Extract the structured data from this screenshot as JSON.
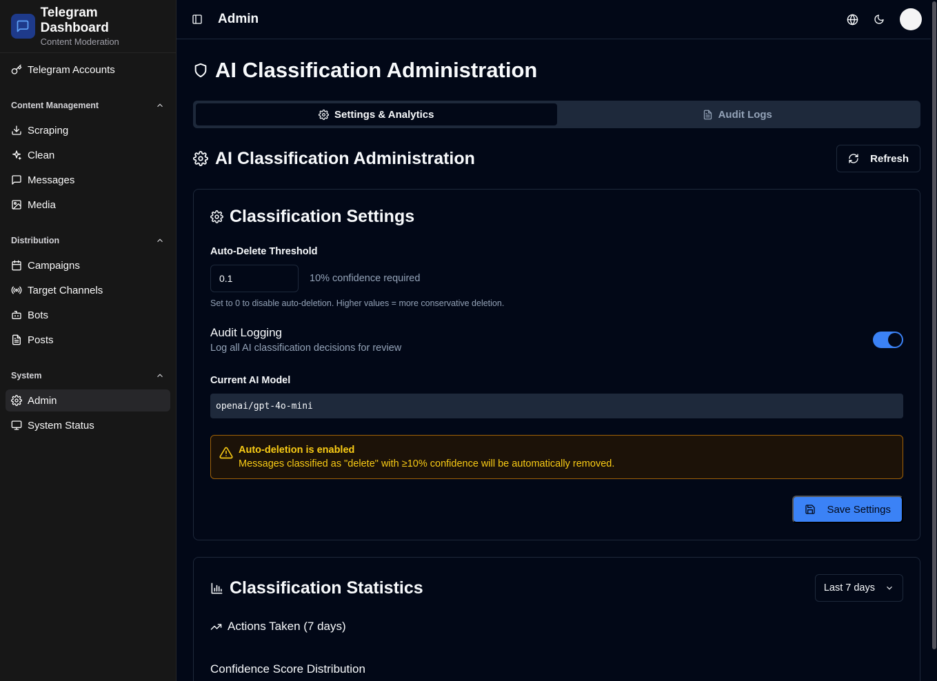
{
  "brand": {
    "title": "Telegram Dashboard",
    "subtitle": "Content Moderation"
  },
  "sidebar": {
    "top_items": [
      {
        "label": "Telegram Accounts",
        "icon": "key-icon"
      }
    ],
    "groups": [
      {
        "title": "Content Management",
        "items": [
          {
            "label": "Scraping",
            "icon": "download-icon"
          },
          {
            "label": "Clean",
            "icon": "sparkles-icon"
          },
          {
            "label": "Messages",
            "icon": "message-square-icon"
          },
          {
            "label": "Media",
            "icon": "image-icon"
          }
        ]
      },
      {
        "title": "Distribution",
        "items": [
          {
            "label": "Campaigns",
            "icon": "calendar-icon"
          },
          {
            "label": "Target Channels",
            "icon": "radio-icon"
          },
          {
            "label": "Bots",
            "icon": "bot-icon"
          },
          {
            "label": "Posts",
            "icon": "file-text-icon"
          }
        ]
      },
      {
        "title": "System",
        "items": [
          {
            "label": "Admin",
            "icon": "settings-icon",
            "active": true
          },
          {
            "label": "System Status",
            "icon": "monitor-icon"
          }
        ]
      }
    ]
  },
  "topbar": {
    "title": "Admin"
  },
  "page": {
    "title": "AI Classification Administration",
    "tabs": [
      {
        "label": "Settings & Analytics"
      },
      {
        "label": "Audit Logs"
      }
    ],
    "section_title": "AI Classification Administration",
    "refresh_label": "Refresh"
  },
  "settings": {
    "title": "Classification Settings",
    "threshold_label": "Auto-Delete Threshold",
    "threshold_value": "0.1",
    "threshold_hint": "10% confidence required",
    "threshold_help": "Set to 0 to disable auto-deletion. Higher values = more conservative deletion.",
    "audit_title": "Audit Logging",
    "audit_desc": "Log all AI classification decisions for review",
    "audit_enabled": true,
    "model_label": "Current AI Model",
    "model_value": "openai/gpt-4o-mini",
    "alert_title": "Auto-deletion is enabled",
    "alert_text": "Messages classified as \"delete\" with ≥10% confidence will be automatically removed.",
    "save_label": "Save Settings"
  },
  "stats": {
    "title": "Classification Statistics",
    "period": "Last 7 days",
    "actions_title": "Actions Taken (7 days)",
    "distribution_title": "Confidence Score Distribution"
  },
  "colors": {
    "accent": "#3b82f6",
    "warning": "#facc15",
    "background": "#020817",
    "sidebar": "#171717"
  }
}
